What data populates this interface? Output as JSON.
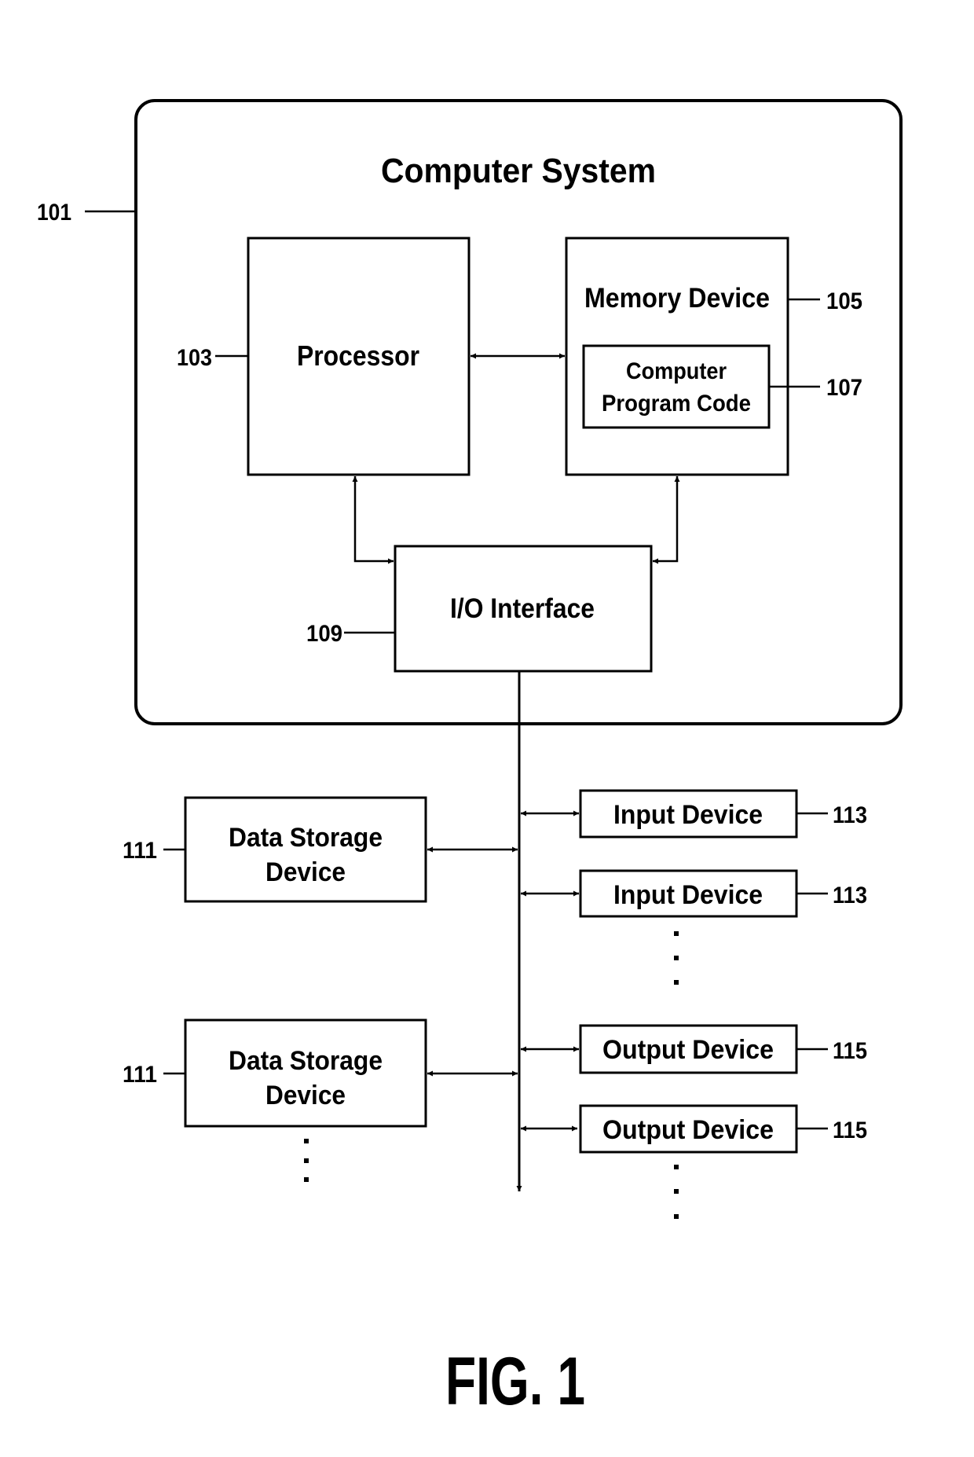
{
  "figure": {
    "caption": "FIG. 1",
    "system": {
      "title": "Computer System",
      "ref": "101"
    },
    "processor": {
      "label": "Processor",
      "ref": "103"
    },
    "memory": {
      "label": "Memory Device",
      "ref": "105"
    },
    "program_code": {
      "line1": "Computer",
      "line2": "Program Code",
      "ref": "107"
    },
    "io_interface": {
      "label": "I/O Interface",
      "ref": "109"
    },
    "data_storage": [
      {
        "line1": "Data Storage",
        "line2": "Device",
        "ref": "111"
      },
      {
        "line1": "Data Storage",
        "line2": "Device",
        "ref": "111"
      }
    ],
    "input_devices": [
      {
        "label": "Input Device",
        "ref": "113"
      },
      {
        "label": "Input Device",
        "ref": "113"
      }
    ],
    "output_devices": [
      {
        "label": "Output Device",
        "ref": "115"
      },
      {
        "label": "Output Device",
        "ref": "115"
      }
    ],
    "ellipsis": "⋮"
  }
}
